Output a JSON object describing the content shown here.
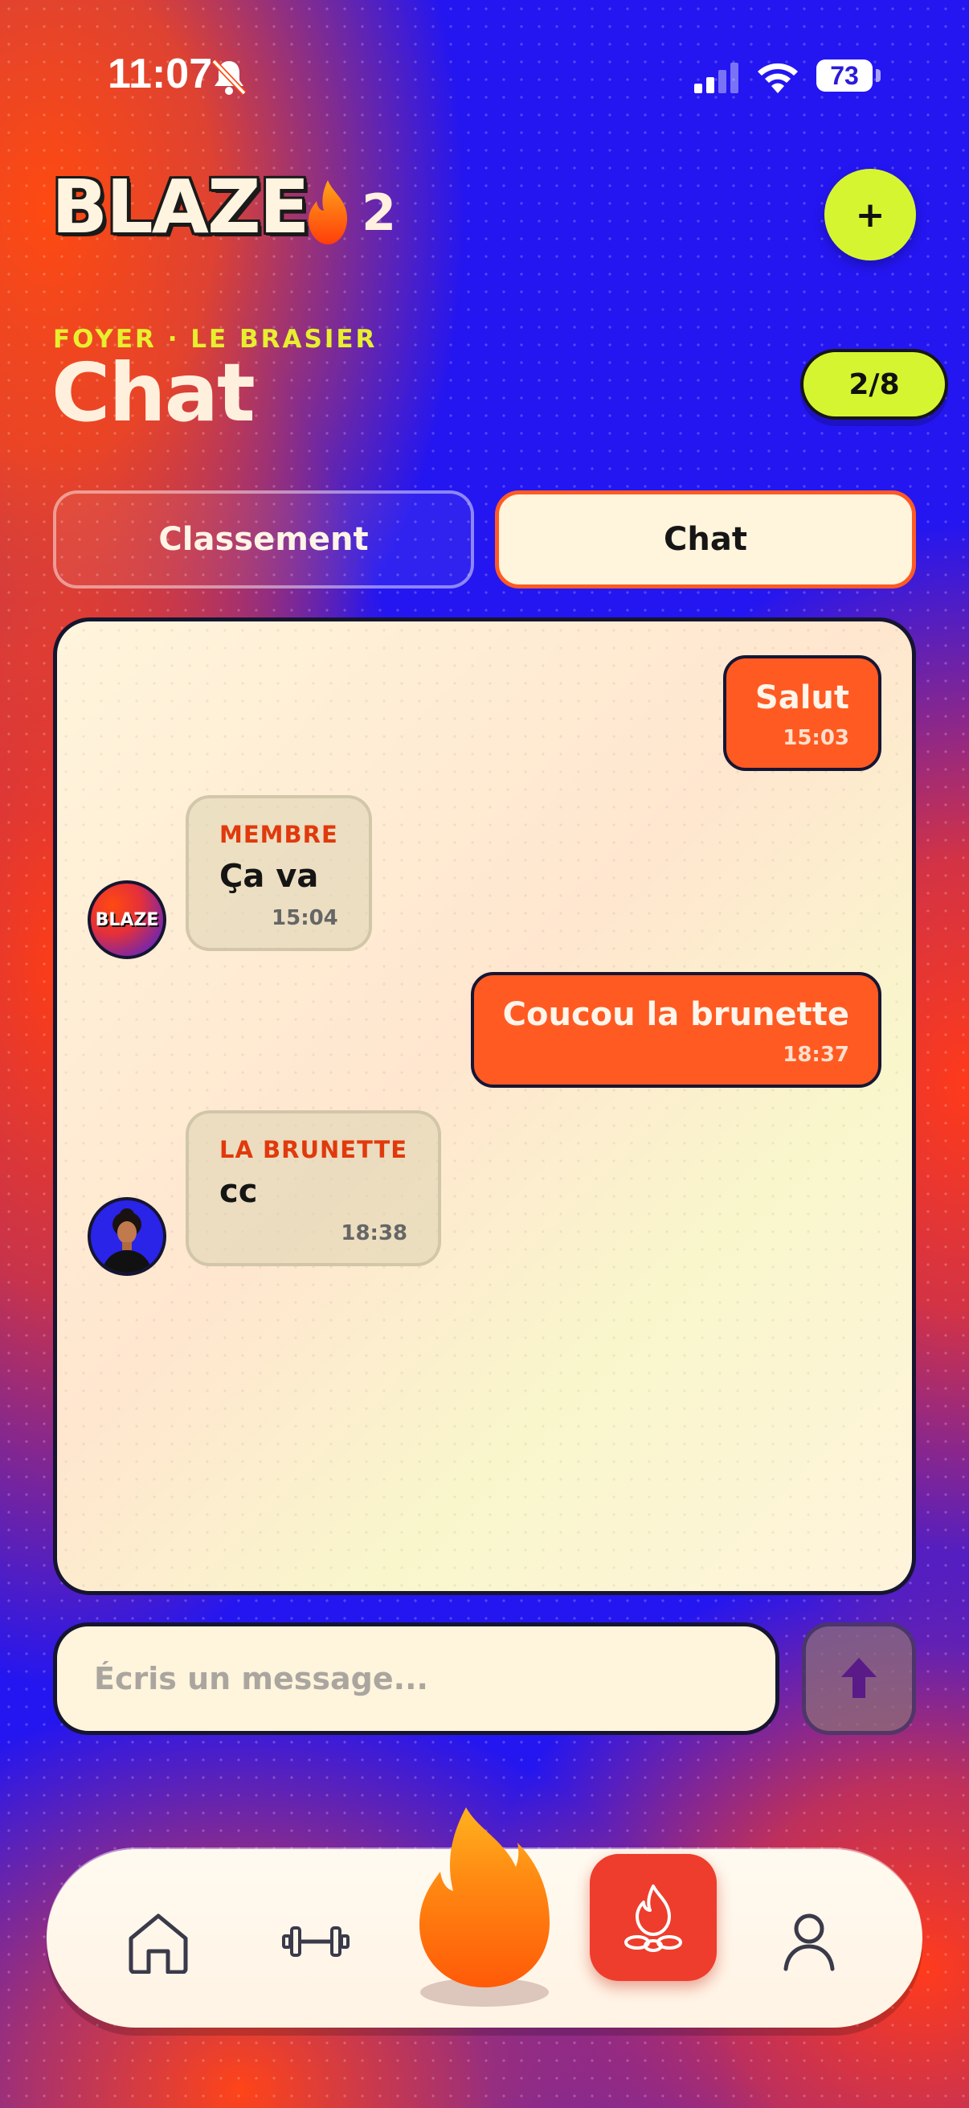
{
  "status_bar": {
    "time": "11:07",
    "battery": "73"
  },
  "header": {
    "logo": "BLAZE",
    "streak_count": "2",
    "add_label": "+"
  },
  "page": {
    "subtitle": "FOYER · LE BRASIER",
    "title": "Chat",
    "member_count": "2/8"
  },
  "tabs": [
    {
      "label": "Classement",
      "active": false
    },
    {
      "label": "Chat",
      "active": true
    }
  ],
  "messages": [
    {
      "direction": "out",
      "text": "Salut",
      "time": "15:03"
    },
    {
      "direction": "in",
      "author": "MEMBRE",
      "text": "Ça va",
      "time": "15:04",
      "avatar": "BLAZE"
    },
    {
      "direction": "out",
      "text": "Coucou la brunette",
      "time": "18:37"
    },
    {
      "direction": "in",
      "author": "LA BRUNETTE",
      "text": "cc",
      "time": "18:38"
    }
  ],
  "composer": {
    "placeholder": "Écris un message..."
  },
  "nav": {
    "items": [
      "home-icon",
      "dumbbell-icon",
      "flame-icon",
      "campfire-icon",
      "user-icon"
    ],
    "active": "campfire-icon"
  },
  "colors": {
    "accent": "#ff5a22",
    "lime": "#d6f531",
    "background_blue": "#2416f0",
    "cream": "#fff4dc"
  }
}
